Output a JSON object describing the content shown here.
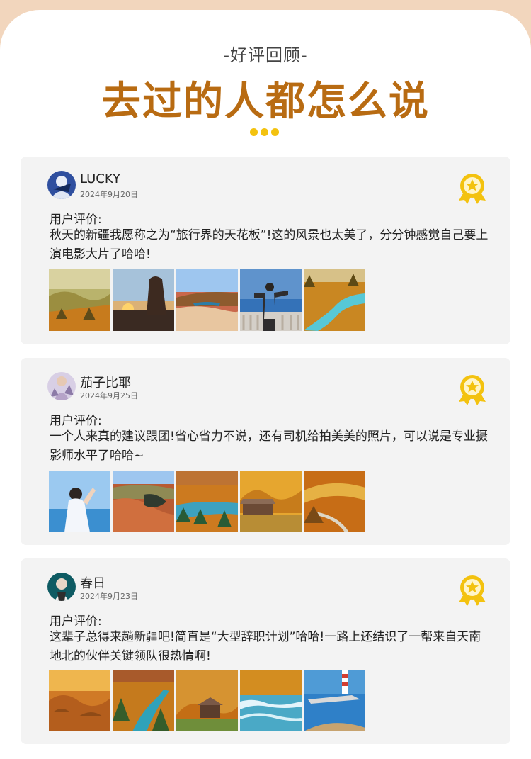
{
  "header": {
    "kicker": "-好评回顾-",
    "title": "去过的人都怎么说"
  },
  "reviews": [
    {
      "name": "LUCKY",
      "date": "2024年9月20日",
      "label": "用户评价:",
      "comment": "秋天的新疆我愿称之为“旅行界的天花板”!这的风景也太美了，分分钟感觉自己要上演电影大片了哈哈!",
      "photos": [
        "autumn-forest-valley",
        "desert-rock-sunset",
        "colorful-lake-hills",
        "person-lake-platform",
        "turquoise-river-forest"
      ]
    },
    {
      "name": "茄子比耶",
      "date": "2024年9月25日",
      "label": "用户评价:",
      "comment": "一个人来真的建议跟团!省心省力不说，还有司机给拍美美的照片，可以说是专业摄影师水平了哈哈~",
      "photos": [
        "woman-lakeside",
        "red-canyon-lake",
        "autumn-river-bend",
        "wooden-cabin-forest",
        "golden-hills-road"
      ]
    },
    {
      "name": "春日",
      "date": "2024年9月23日",
      "label": "用户评价:",
      "comment": "这辈子总得来趟新疆吧!简直是“大型辞职计划”哈哈!一路上还结识了一帮来自天南地北的伙伴关键领队很热情啊!",
      "photos": [
        "golden-desert-rocks",
        "autumn-stream",
        "cabin-autumn-trees",
        "river-rapids",
        "lighthouse-lake"
      ]
    }
  ],
  "colors": {
    "title": "#b86b12",
    "dots": "#f3c20f",
    "badge": "#f3c20f",
    "card": "#f3f3f3"
  }
}
